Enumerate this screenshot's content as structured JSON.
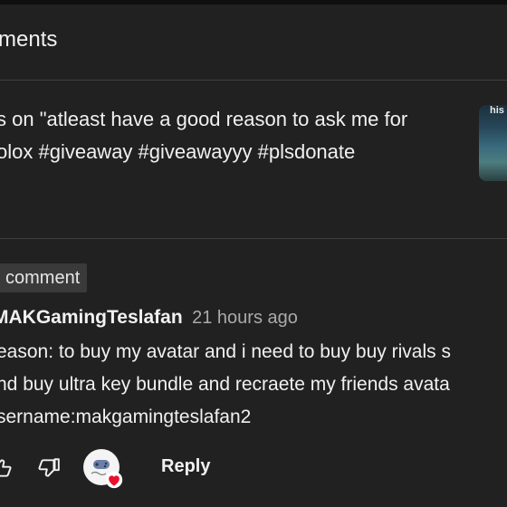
{
  "panel": {
    "title": "ments"
  },
  "video": {
    "line1": "s on \"atleast have a good reason to ask me for",
    "line2": "olox #giveaway #giveawayyy #plsdonate",
    "thumbnail_text": "his"
  },
  "pinned": {
    "chip_label": "comment"
  },
  "comment": {
    "author": "MAKGamingTeslafan",
    "time": "21 hours ago",
    "lines": [
      "eason: to buy my avatar and i need to buy buy rivals s",
      "nd buy ultra key bundle and recraete my friends avata",
      "sername:makgamingteslafan2"
    ]
  },
  "actions": {
    "like_icon": "thumb-up-icon",
    "dislike_icon": "thumb-down-icon",
    "heart_icon": "creator-heart-icon",
    "reply_label": "Reply"
  },
  "colors": {
    "background": "#212121",
    "text": "#f1f1f1",
    "secondary_text": "#aaaaaa",
    "divider": "#3f3f3f",
    "heart": "#e8112d"
  }
}
